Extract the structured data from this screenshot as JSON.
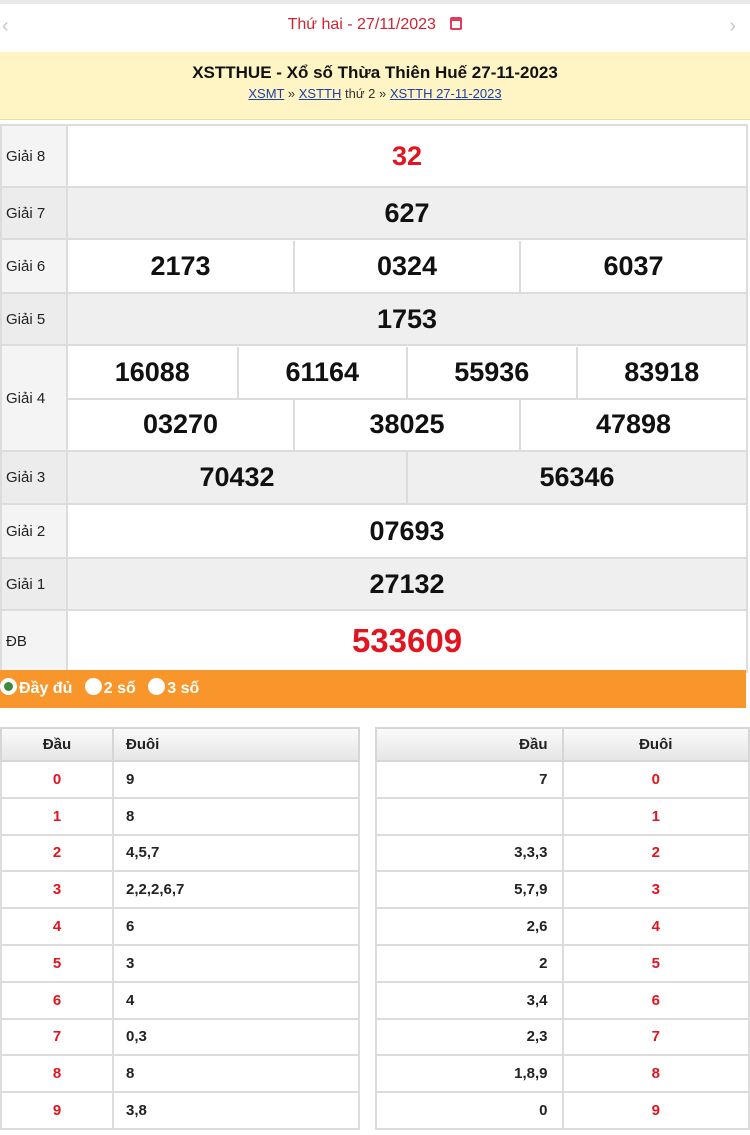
{
  "date_nav": {
    "prev_icon": "chevron-left-icon",
    "next_icon": "chevron-right-icon",
    "day_label": "Thứ hai - ",
    "date": "27/11/2023",
    "calendar_icon": "calendar-icon"
  },
  "title": {
    "text": "XSTTHUE - Xổ số Thừa Thiên Huế 27-11-2023",
    "crumb_1": "XSMT",
    "sep_1": " » ",
    "crumb_2": "XSTTH",
    "crumb_mid": " thứ 2",
    "sep_2": " » ",
    "crumb_3": "XSTTH 27-11-2023"
  },
  "results": {
    "g8_label": "Giải 8",
    "g8": "32",
    "g7_label": "Giải 7",
    "g7": "627",
    "g6_label": "Giải 6",
    "g6": [
      "2173",
      "0324",
      "6037"
    ],
    "g5_label": "Giải 5",
    "g5": "1753",
    "g4_label": "Giải 4",
    "g4_row1": [
      "16088",
      "61164",
      "55936",
      "83918"
    ],
    "g4_row2": [
      "03270",
      "38025",
      "47898"
    ],
    "g3_label": "Giải 3",
    "g3": [
      "70432",
      "56346"
    ],
    "g2_label": "Giải 2",
    "g2": "07693",
    "g1_label": "Giải 1",
    "g1": "27132",
    "db_label": "ĐB",
    "db": "533609"
  },
  "options": {
    "full": "Đầy đủ",
    "two": "2 số",
    "three": "3 số",
    "selected": "full"
  },
  "loto_left": {
    "head_col": "Đầu",
    "tail_col": "Đuôi",
    "rows": [
      {
        "head": "0",
        "tails": "9"
      },
      {
        "head": "1",
        "tails": "8"
      },
      {
        "head": "2",
        "tails": "4,5,7"
      },
      {
        "head": "3",
        "tails": "2,2,2,6,7"
      },
      {
        "head": "4",
        "tails": "6"
      },
      {
        "head": "5",
        "tails": "3"
      },
      {
        "head": "6",
        "tails": "4"
      },
      {
        "head": "7",
        "tails": "0,3"
      },
      {
        "head": "8",
        "tails": "8"
      },
      {
        "head": "9",
        "tails": "3,8"
      }
    ]
  },
  "loto_right": {
    "head_col": "Đầu",
    "tail_col": "Đuôi",
    "rows": [
      {
        "heads": "7",
        "tail": "0"
      },
      {
        "heads": "",
        "tail": "1"
      },
      {
        "heads": "3,3,3",
        "tail": "2"
      },
      {
        "heads": "5,7,9",
        "tail": "3"
      },
      {
        "heads": "2,6",
        "tail": "4"
      },
      {
        "heads": "2",
        "tail": "5"
      },
      {
        "heads": "3,4",
        "tail": "6"
      },
      {
        "heads": "2,3",
        "tail": "7"
      },
      {
        "heads": "1,8,9",
        "tail": "8"
      },
      {
        "heads": "0",
        "tail": "9"
      }
    ]
  },
  "colors": {
    "accent_red": "#e1141f",
    "title_bg": "#fef4c4",
    "option_bar": "#f8962c",
    "link": "#1e3ea8"
  }
}
